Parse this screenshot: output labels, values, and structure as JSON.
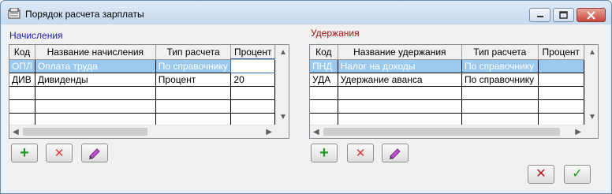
{
  "window": {
    "title": "Порядок расчета зарплаты"
  },
  "accruals": {
    "label": "Начисления",
    "columns": [
      "Код",
      "Название начисления",
      "Тип расчета",
      "Процент"
    ],
    "rows": [
      {
        "code": "ОПЛ",
        "name": "Оплата труда",
        "type": "По справочнику",
        "percent": ""
      },
      {
        "code": "ДИВ",
        "name": "Дивиденды",
        "type": "Процент",
        "percent": "20"
      },
      {
        "code": "",
        "name": "",
        "type": "",
        "percent": ""
      },
      {
        "code": "",
        "name": "",
        "type": "",
        "percent": ""
      },
      {
        "code": "",
        "name": "",
        "type": "",
        "percent": ""
      }
    ]
  },
  "deductions": {
    "label": "Удержания",
    "columns": [
      "Код",
      "Название удержания",
      "Тип расчета",
      "Процент"
    ],
    "rows": [
      {
        "code": "ПНД",
        "name": "Налог на доходы",
        "type": "По справочнику",
        "percent": ""
      },
      {
        "code": "УДА",
        "name": "Удержание аванса",
        "type": "По справочнику",
        "percent": ""
      },
      {
        "code": "",
        "name": "",
        "type": "",
        "percent": ""
      },
      {
        "code": "",
        "name": "",
        "type": "",
        "percent": ""
      },
      {
        "code": "",
        "name": "",
        "type": "",
        "percent": ""
      }
    ]
  },
  "icons": {
    "add": "plus-icon",
    "delete": "delete-x-icon",
    "edit": "pencil-edit-icon",
    "cancel": "cancel-x-icon",
    "ok": "checkmark-icon"
  },
  "colors": {
    "accruals_label": "#1f1fa6",
    "deductions_label": "#a01010",
    "selection": "#99c9ef"
  }
}
